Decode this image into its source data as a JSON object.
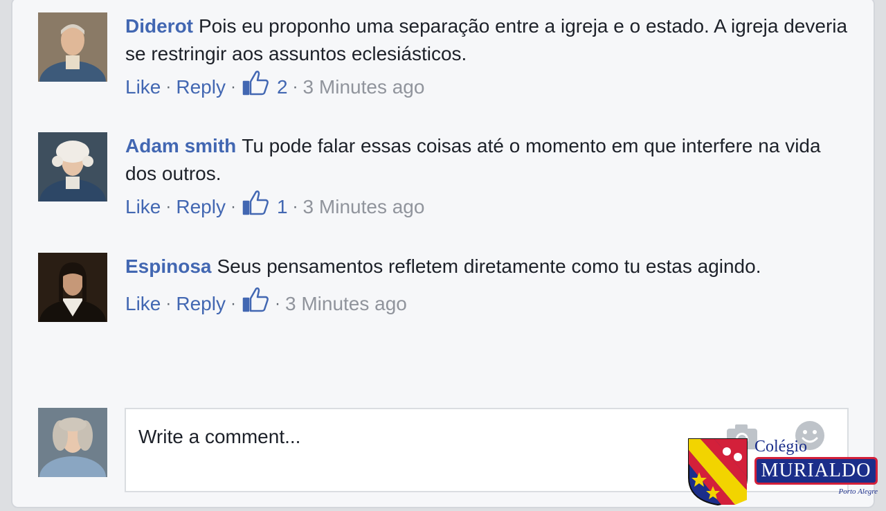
{
  "comments": [
    {
      "author": "Diderot",
      "text": "Pois eu proponho uma separação entre a igreja e o estado. A igreja deveria se restringir aos assuntos eclesiásticos.",
      "like_label": "Like",
      "reply_label": "Reply",
      "likes": "2",
      "time": "3 Minutes ago"
    },
    {
      "author": "Adam smith",
      "text": "Tu pode falar essas coisas até o momento em que interfere na vida dos outros.",
      "like_label": "Like",
      "reply_label": "Reply",
      "likes": "1",
      "time": "3 Minutes ago"
    },
    {
      "author": "Espinosa",
      "text": "Seus pensamentos refletem diretamente como tu estas agindo.",
      "like_label": "Like",
      "reply_label": "Reply",
      "likes": "",
      "time": "3 Minutes ago"
    }
  ],
  "composer": {
    "placeholder": "Write a comment...",
    "icons": [
      "camera-icon",
      "smiley-icon"
    ]
  },
  "watermark": {
    "line1": "Colégio",
    "name": "MURIALDO",
    "city": "Porto Alegre"
  },
  "colors": {
    "accent": "#4267b2",
    "text": "#1d2129",
    "muted": "#90949c",
    "panel": "#f6f7f9"
  }
}
